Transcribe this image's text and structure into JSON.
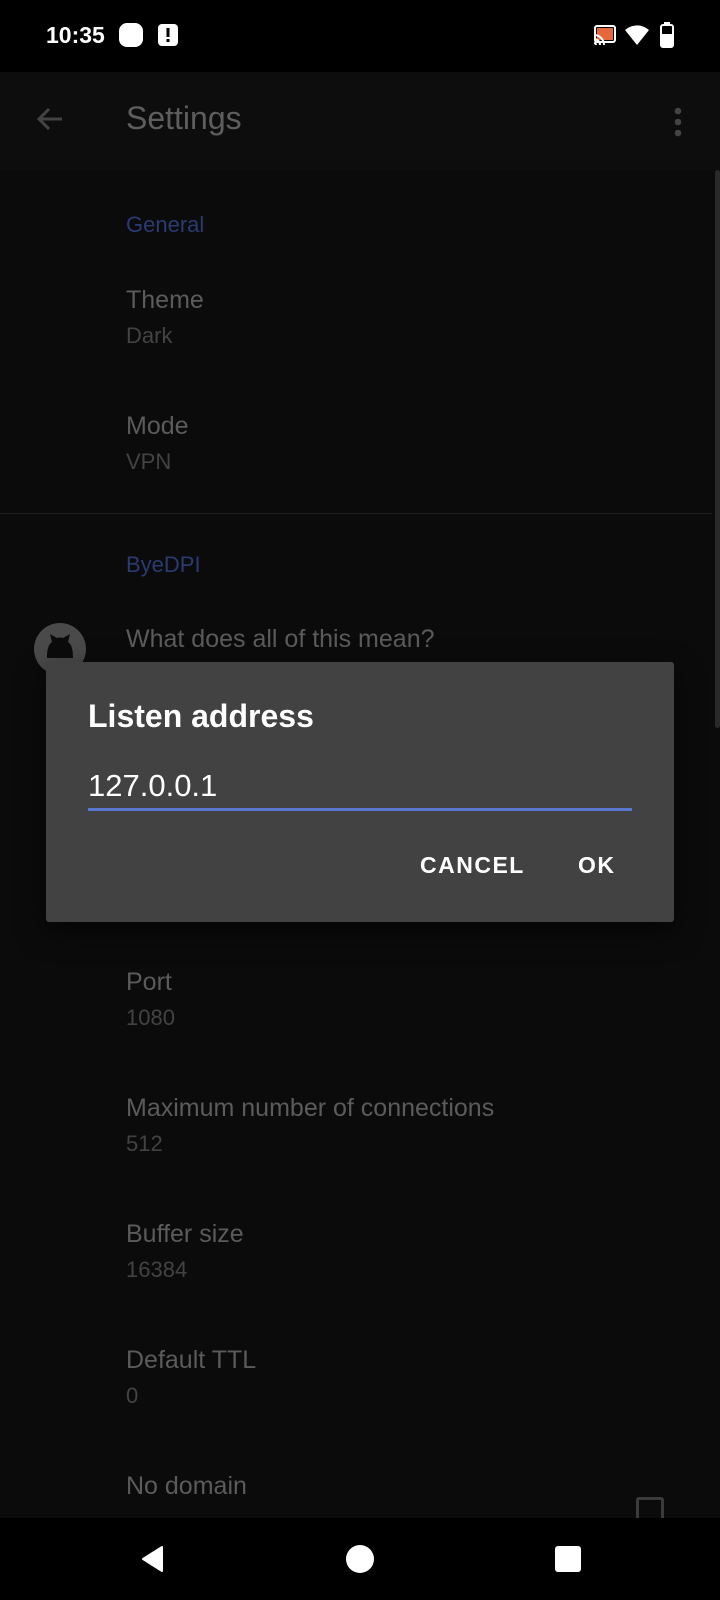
{
  "status_bar": {
    "time": "10:35",
    "icons": [
      "notification-app-icon",
      "alert-icon",
      "cast-icon",
      "wifi-icon",
      "battery-icon"
    ]
  },
  "app_bar": {
    "title": "Settings",
    "back_icon": "arrow-left-icon",
    "menu_icon": "more-vertical-icon"
  },
  "settings": {
    "general_header": "General",
    "theme": {
      "title": "Theme",
      "value": "Dark"
    },
    "mode": {
      "title": "Mode",
      "value": "VPN"
    },
    "byedpi_header": "ByeDPI",
    "help": {
      "title": "What does all of this mean?"
    },
    "port": {
      "title": "Port",
      "value": "1080"
    },
    "max_connections": {
      "title": "Maximum number of connections",
      "value": "512"
    },
    "buffer_size": {
      "title": "Buffer size",
      "value": "16384"
    },
    "default_ttl": {
      "title": "Default TTL",
      "value": "0"
    },
    "no_domain": {
      "title": "No domain",
      "checked": false
    }
  },
  "dialog": {
    "title": "Listen address",
    "input_value": "127.0.0.1",
    "cancel_label": "CANCEL",
    "ok_label": "OK"
  },
  "nav_bar": {
    "icons": [
      "back-triangle-icon",
      "home-circle-icon",
      "recents-square-icon"
    ]
  },
  "colors": {
    "accent": "#5a77cf",
    "dialog_bg": "#424242",
    "category": "#2c3a72"
  }
}
